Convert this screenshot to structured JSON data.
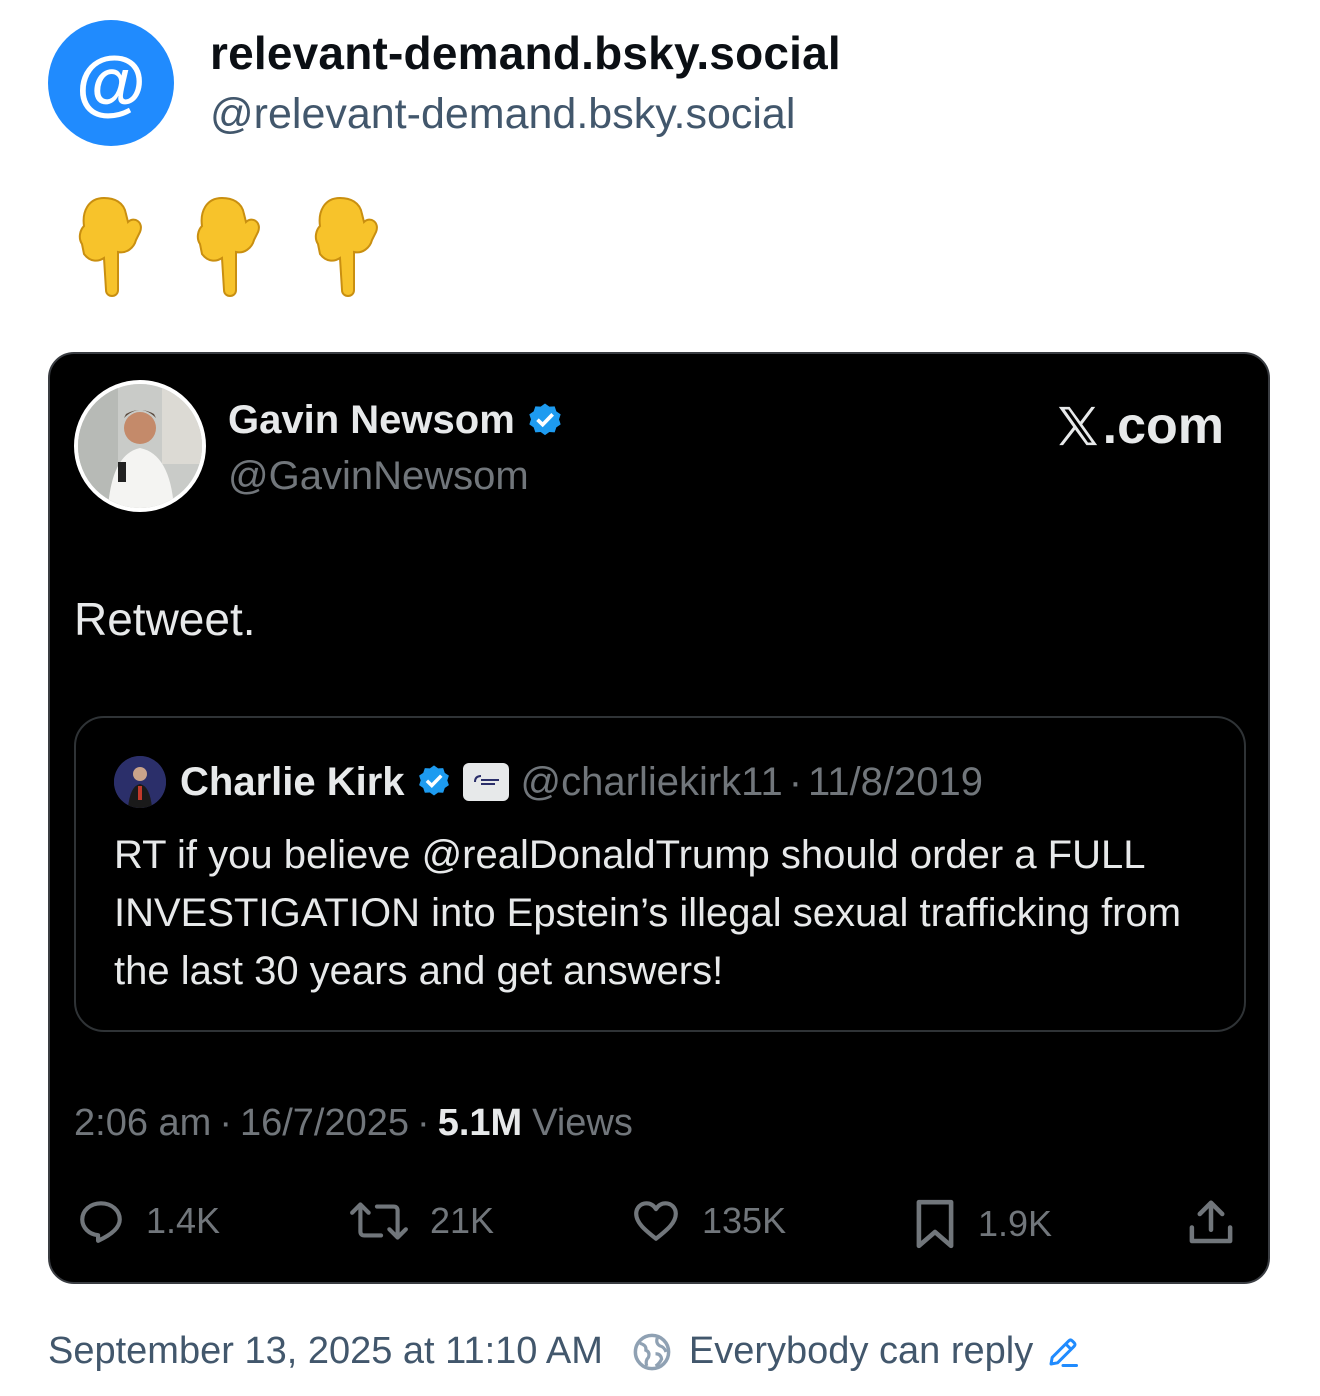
{
  "post": {
    "author_display_name": "relevant-demand.bsky.social",
    "author_handle": "@relevant-demand.bsky.social",
    "avatar_symbol": "@",
    "text": "👇👇👇",
    "timestamp": "September 13, 2025 at 11:10 AM",
    "reply_setting": "Everybody can reply"
  },
  "embed": {
    "source_label": ".com",
    "author_name": "Gavin Newsom",
    "author_handle": "@GavinNewsom",
    "text": "Retweet.",
    "quoted": {
      "author_name": "Charlie Kirk",
      "author_handle": "@charliekirk11",
      "separator": "·",
      "date": "11/8/2019",
      "text": "RT if you believe @realDonaldTrump should order a FULL INVESTIGATION into Epstein’s illegal sexual trafficking from the last 30 years and get answers!"
    },
    "time": "2:06 am",
    "date": "16/7/2025",
    "views_count": "5.1M",
    "views_label": "Views",
    "separator": "·",
    "stats": {
      "replies": "1.4K",
      "retweets": "21K",
      "likes": "135K",
      "bookmarks": "1.9K"
    }
  },
  "colors": {
    "bsky_blue": "#208bfe",
    "x_verified": "#1d9bf0",
    "embed_bg": "#000000",
    "muted_text": "#71767b"
  }
}
